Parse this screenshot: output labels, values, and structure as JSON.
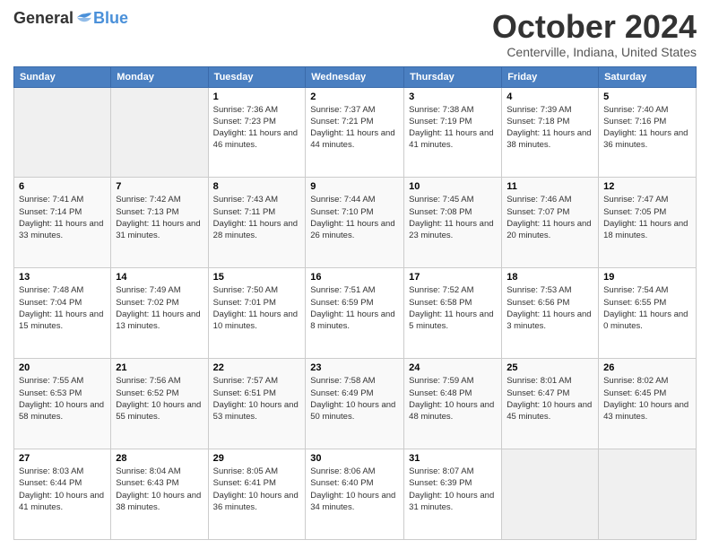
{
  "logo": {
    "general": "General",
    "blue": "Blue"
  },
  "header": {
    "month": "October 2024",
    "location": "Centerville, Indiana, United States"
  },
  "days_of_week": [
    "Sunday",
    "Monday",
    "Tuesday",
    "Wednesday",
    "Thursday",
    "Friday",
    "Saturday"
  ],
  "weeks": [
    [
      {
        "day": "",
        "empty": true
      },
      {
        "day": "",
        "empty": true
      },
      {
        "day": "1",
        "sunrise": "7:36 AM",
        "sunset": "7:23 PM",
        "daylight": "11 hours and 46 minutes."
      },
      {
        "day": "2",
        "sunrise": "7:37 AM",
        "sunset": "7:21 PM",
        "daylight": "11 hours and 44 minutes."
      },
      {
        "day": "3",
        "sunrise": "7:38 AM",
        "sunset": "7:19 PM",
        "daylight": "11 hours and 41 minutes."
      },
      {
        "day": "4",
        "sunrise": "7:39 AM",
        "sunset": "7:18 PM",
        "daylight": "11 hours and 38 minutes."
      },
      {
        "day": "5",
        "sunrise": "7:40 AM",
        "sunset": "7:16 PM",
        "daylight": "11 hours and 36 minutes."
      }
    ],
    [
      {
        "day": "6",
        "sunrise": "7:41 AM",
        "sunset": "7:14 PM",
        "daylight": "11 hours and 33 minutes."
      },
      {
        "day": "7",
        "sunrise": "7:42 AM",
        "sunset": "7:13 PM",
        "daylight": "11 hours and 31 minutes."
      },
      {
        "day": "8",
        "sunrise": "7:43 AM",
        "sunset": "7:11 PM",
        "daylight": "11 hours and 28 minutes."
      },
      {
        "day": "9",
        "sunrise": "7:44 AM",
        "sunset": "7:10 PM",
        "daylight": "11 hours and 26 minutes."
      },
      {
        "day": "10",
        "sunrise": "7:45 AM",
        "sunset": "7:08 PM",
        "daylight": "11 hours and 23 minutes."
      },
      {
        "day": "11",
        "sunrise": "7:46 AM",
        "sunset": "7:07 PM",
        "daylight": "11 hours and 20 minutes."
      },
      {
        "day": "12",
        "sunrise": "7:47 AM",
        "sunset": "7:05 PM",
        "daylight": "11 hours and 18 minutes."
      }
    ],
    [
      {
        "day": "13",
        "sunrise": "7:48 AM",
        "sunset": "7:04 PM",
        "daylight": "11 hours and 15 minutes."
      },
      {
        "day": "14",
        "sunrise": "7:49 AM",
        "sunset": "7:02 PM",
        "daylight": "11 hours and 13 minutes."
      },
      {
        "day": "15",
        "sunrise": "7:50 AM",
        "sunset": "7:01 PM",
        "daylight": "11 hours and 10 minutes."
      },
      {
        "day": "16",
        "sunrise": "7:51 AM",
        "sunset": "6:59 PM",
        "daylight": "11 hours and 8 minutes."
      },
      {
        "day": "17",
        "sunrise": "7:52 AM",
        "sunset": "6:58 PM",
        "daylight": "11 hours and 5 minutes."
      },
      {
        "day": "18",
        "sunrise": "7:53 AM",
        "sunset": "6:56 PM",
        "daylight": "11 hours and 3 minutes."
      },
      {
        "day": "19",
        "sunrise": "7:54 AM",
        "sunset": "6:55 PM",
        "daylight": "11 hours and 0 minutes."
      }
    ],
    [
      {
        "day": "20",
        "sunrise": "7:55 AM",
        "sunset": "6:53 PM",
        "daylight": "10 hours and 58 minutes."
      },
      {
        "day": "21",
        "sunrise": "7:56 AM",
        "sunset": "6:52 PM",
        "daylight": "10 hours and 55 minutes."
      },
      {
        "day": "22",
        "sunrise": "7:57 AM",
        "sunset": "6:51 PM",
        "daylight": "10 hours and 53 minutes."
      },
      {
        "day": "23",
        "sunrise": "7:58 AM",
        "sunset": "6:49 PM",
        "daylight": "10 hours and 50 minutes."
      },
      {
        "day": "24",
        "sunrise": "7:59 AM",
        "sunset": "6:48 PM",
        "daylight": "10 hours and 48 minutes."
      },
      {
        "day": "25",
        "sunrise": "8:01 AM",
        "sunset": "6:47 PM",
        "daylight": "10 hours and 45 minutes."
      },
      {
        "day": "26",
        "sunrise": "8:02 AM",
        "sunset": "6:45 PM",
        "daylight": "10 hours and 43 minutes."
      }
    ],
    [
      {
        "day": "27",
        "sunrise": "8:03 AM",
        "sunset": "6:44 PM",
        "daylight": "10 hours and 41 minutes."
      },
      {
        "day": "28",
        "sunrise": "8:04 AM",
        "sunset": "6:43 PM",
        "daylight": "10 hours and 38 minutes."
      },
      {
        "day": "29",
        "sunrise": "8:05 AM",
        "sunset": "6:41 PM",
        "daylight": "10 hours and 36 minutes."
      },
      {
        "day": "30",
        "sunrise": "8:06 AM",
        "sunset": "6:40 PM",
        "daylight": "10 hours and 34 minutes."
      },
      {
        "day": "31",
        "sunrise": "8:07 AM",
        "sunset": "6:39 PM",
        "daylight": "10 hours and 31 minutes."
      },
      {
        "day": "",
        "empty": true
      },
      {
        "day": "",
        "empty": true
      }
    ]
  ],
  "labels": {
    "sunrise": "Sunrise:",
    "sunset": "Sunset:",
    "daylight": "Daylight:"
  }
}
